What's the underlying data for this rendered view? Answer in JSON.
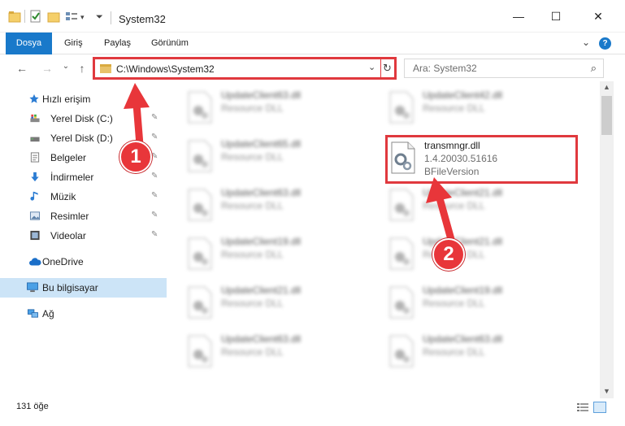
{
  "window": {
    "title": "System32",
    "minimize": "—",
    "maximize": "☐",
    "close": "✕"
  },
  "ribbon": {
    "tabs": [
      "Dosya",
      "Giriş",
      "Paylaş",
      "Görünüm"
    ],
    "expand": "⌄",
    "help": "?"
  },
  "address": {
    "path": "C:\\Windows\\System32",
    "dropdown": "⌄",
    "refresh": "↻"
  },
  "search": {
    "placeholder": "Ara: System32",
    "icon": "⌕"
  },
  "nav_buttons": {
    "back": "←",
    "forward": "→",
    "recent": "⌄",
    "up": "↑"
  },
  "sidebar": {
    "quick_access": "Hızlı erişim",
    "items": [
      {
        "label": "Yerel Disk (C:)",
        "icon": "drive-icon",
        "pinned": true
      },
      {
        "label": "Yerel Disk (D:)",
        "icon": "drive-icon",
        "pinned": true
      },
      {
        "label": "Belgeler",
        "icon": "documents-icon",
        "pinned": true
      },
      {
        "label": "İndirmeler",
        "icon": "downloads-icon",
        "pinned": true
      },
      {
        "label": "Müzik",
        "icon": "music-icon",
        "pinned": true
      },
      {
        "label": "Resimler",
        "icon": "pictures-icon",
        "pinned": true
      },
      {
        "label": "Videolar",
        "icon": "videos-icon",
        "pinned": true
      }
    ],
    "onedrive": "OneDrive",
    "this_pc": "Bu bilgisayar",
    "network": "Ağ",
    "pin_glyph": "📌"
  },
  "files": {
    "left_column": [
      {
        "name": "UpdateClient63.dll",
        "type": "Resource DLL"
      },
      {
        "name": "UpdateClient65.dll",
        "type": "Resource DLL"
      },
      {
        "name": "UpdateClient63.dll",
        "type": "Resource DLL"
      },
      {
        "name": "UpdateClient19.dll",
        "type": "Resource DLL"
      },
      {
        "name": "UpdateClient21.dll",
        "type": "Resource DLL"
      },
      {
        "name": "UpdateClient63.dll",
        "type": "Resource DLL"
      }
    ],
    "right_column": [
      {
        "name": "UpdateClient42.dll",
        "type": "Resource DLL"
      },
      {
        "name": "UpdateClient21.dll",
        "type": "Resource DLL"
      },
      {
        "name": "UpdateClient21.dll",
        "type": "Resource DLL"
      },
      {
        "name": "UpdateClient19.dll",
        "type": "Resource DLL"
      },
      {
        "name": "UpdateClient63.dll",
        "type": "Resource DLL"
      }
    ],
    "highlighted": {
      "name": "transmngr.dll",
      "version": "1.4.20030.51616",
      "description": "BFileVersion"
    }
  },
  "callouts": {
    "one": "1",
    "two": "2"
  },
  "status": {
    "count": "131 öğe"
  },
  "colors": {
    "accent": "#1979ca",
    "callout": "#e8363a",
    "selection": "#cce4f7"
  }
}
